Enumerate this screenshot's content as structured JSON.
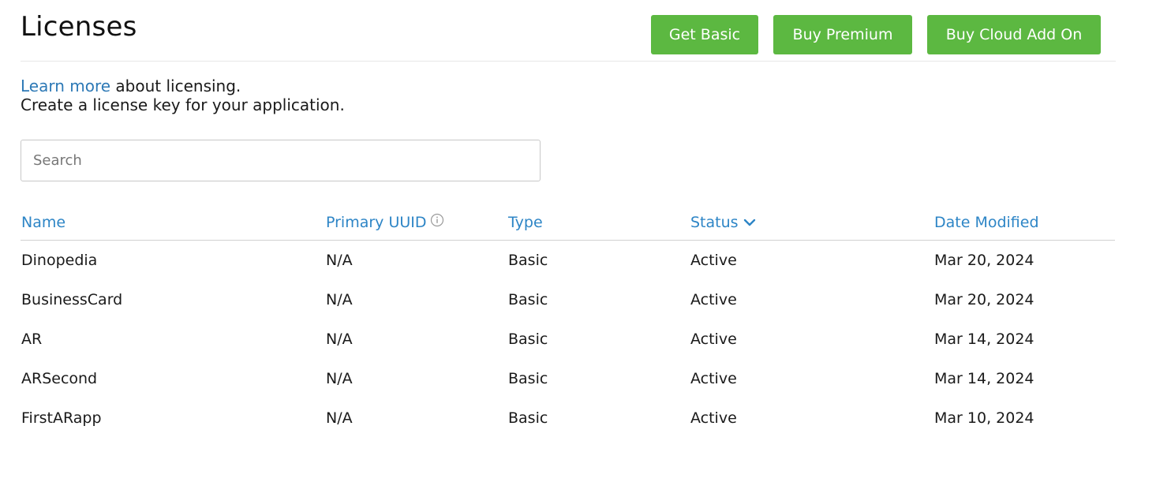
{
  "header": {
    "title": "Licenses",
    "buttons": {
      "get_basic": "Get Basic",
      "buy_premium": "Buy Premium",
      "buy_cloud": "Buy Cloud Add On"
    }
  },
  "intro": {
    "link_text": "Learn more",
    "line1_rest": " about licensing.",
    "line2": "Create a license key for your application."
  },
  "search": {
    "placeholder": "Search",
    "value": ""
  },
  "table": {
    "columns": {
      "name": "Name",
      "uuid": "Primary UUID",
      "type": "Type",
      "status": "Status",
      "date": "Date Modified"
    },
    "sorted_by": "Status",
    "rows": [
      {
        "name": "Dinopedia",
        "uuid": "N/A",
        "type": "Basic",
        "status": "Active",
        "date": "Mar 20, 2024"
      },
      {
        "name": "BusinessCard",
        "uuid": "N/A",
        "type": "Basic",
        "status": "Active",
        "date": "Mar 20, 2024"
      },
      {
        "name": "AR",
        "uuid": "N/A",
        "type": "Basic",
        "status": "Active",
        "date": "Mar 14, 2024"
      },
      {
        "name": "ARSecond",
        "uuid": "N/A",
        "type": "Basic",
        "status": "Active",
        "date": "Mar 14, 2024"
      },
      {
        "name": "FirstARapp",
        "uuid": "N/A",
        "type": "Basic",
        "status": "Active",
        "date": "Mar 10, 2024"
      }
    ]
  },
  "colors": {
    "primary_button": "#5cb841",
    "link": "#2d79b6",
    "header_link": "#2d85c6"
  },
  "icons": {
    "uuid_info": "info-circle-icon",
    "status_sort": "chevron-down-icon"
  }
}
